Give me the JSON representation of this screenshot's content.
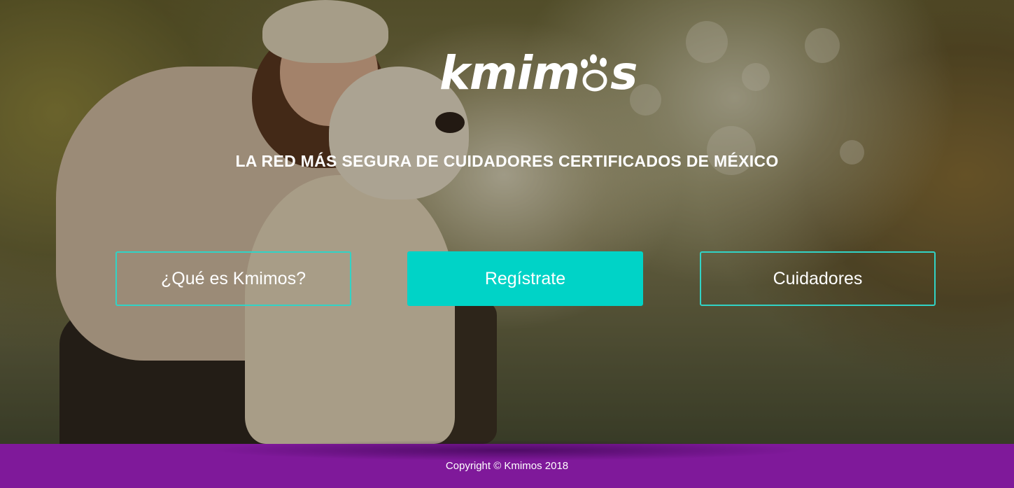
{
  "brand": {
    "logo_text": "kmim",
    "logo_suffix": "s"
  },
  "hero": {
    "tagline": "LA RED MÁS SEGURA DE CUIDADORES CERTIFICADOS DE MÉXICO"
  },
  "buttons": {
    "about": "¿Qué es Kmimos?",
    "register": "Regístrate",
    "caregivers": "Cuidadores"
  },
  "footer": {
    "copyright": "Copyright © Kmimos 2018"
  },
  "colors": {
    "accent_teal": "#00d3c7",
    "footer_purple": "#7f199a",
    "text": "#ffffff"
  }
}
